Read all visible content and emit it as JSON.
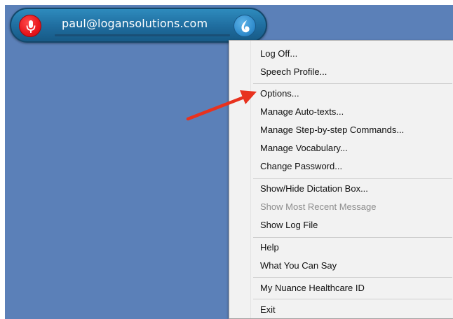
{
  "dictation_bar": {
    "user_email": "paul@logansolutions.com",
    "mic_icon": "microphone-icon",
    "dragon_icon": "dragon-logo-icon",
    "mic_color": "#e8161c",
    "bar_color": "#1f6c9e"
  },
  "menu": {
    "items": [
      {
        "label": "Log Off...",
        "enabled": true
      },
      {
        "label": "Speech Profile...",
        "enabled": true
      },
      {
        "label": "Options...",
        "enabled": true
      },
      {
        "label": "Manage Auto-texts...",
        "enabled": true
      },
      {
        "label": "Manage Step-by-step Commands...",
        "enabled": true
      },
      {
        "label": "Manage Vocabulary...",
        "enabled": true
      },
      {
        "label": "Change Password...",
        "enabled": true
      },
      {
        "label": "Show/Hide Dictation Box...",
        "enabled": true
      },
      {
        "label": "Show Most Recent Message",
        "enabled": false
      },
      {
        "label": "Show Log File",
        "enabled": true
      },
      {
        "label": "Help",
        "enabled": true
      },
      {
        "label": "What You Can Say",
        "enabled": true
      },
      {
        "label": "My Nuance Healthcare ID",
        "enabled": true
      },
      {
        "label": "Exit",
        "enabled": true
      }
    ]
  },
  "annotation": {
    "arrow_color": "#e8321e",
    "points_to": "Options..."
  },
  "desktop_color": "#5b80b8"
}
